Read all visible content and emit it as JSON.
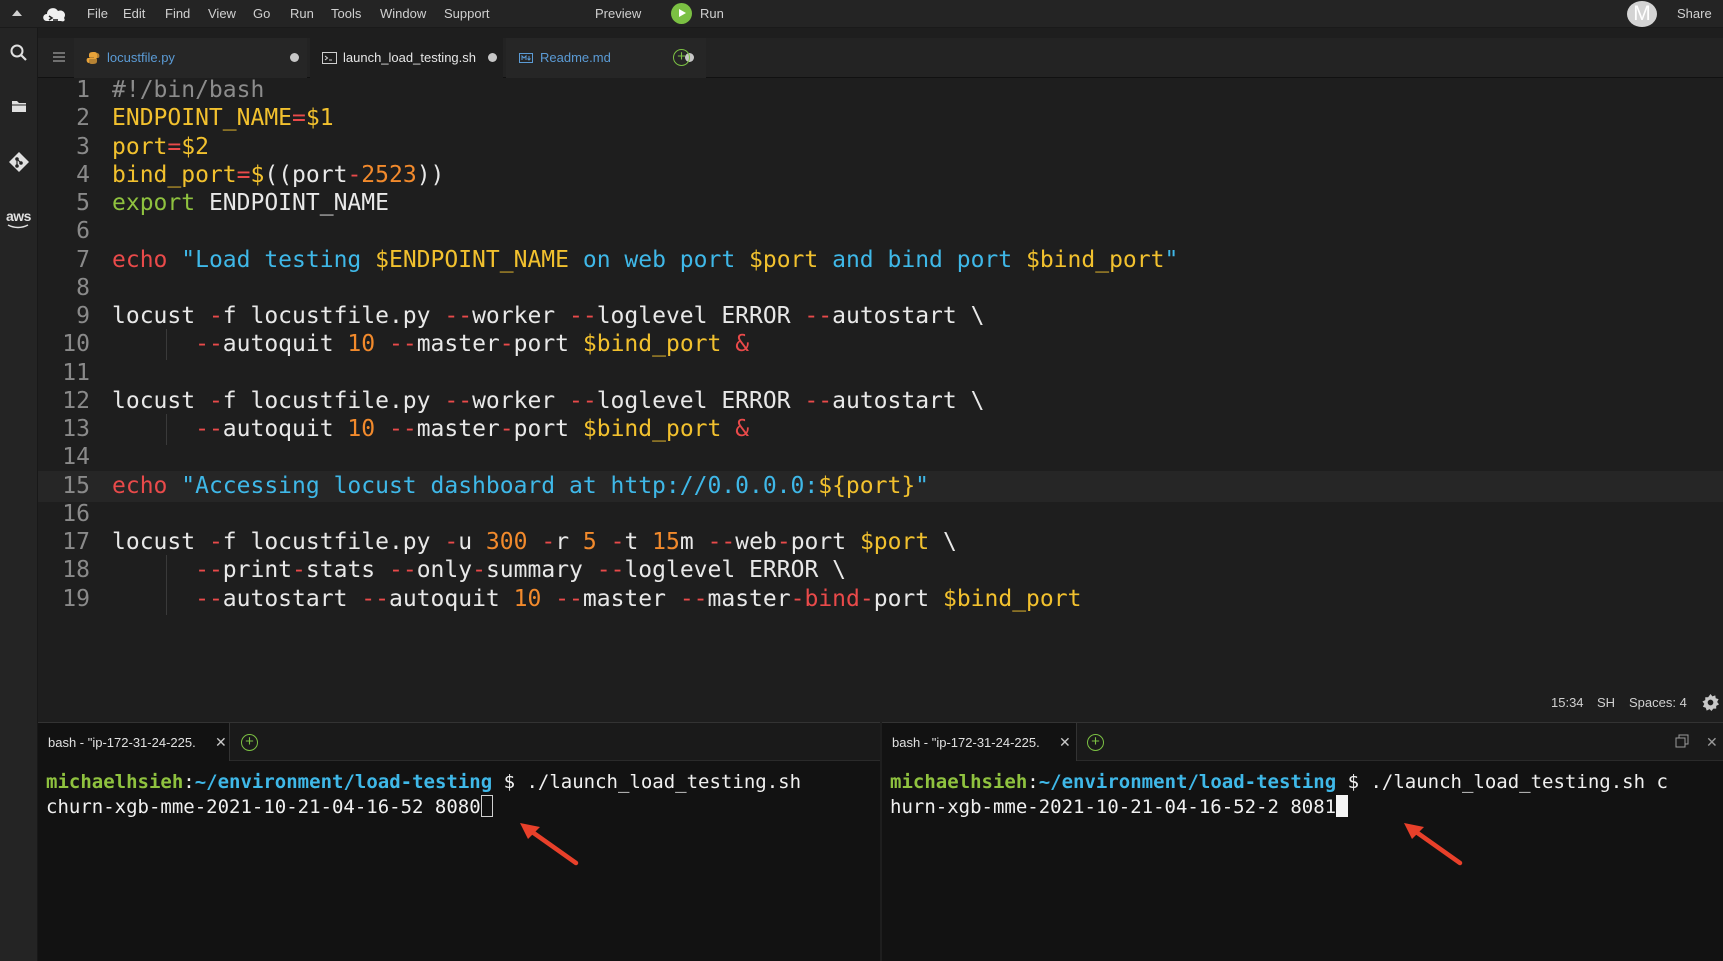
{
  "menubar": {
    "items": [
      "File",
      "Edit",
      "Find",
      "View",
      "Go",
      "Run",
      "Tools",
      "Window",
      "Support"
    ],
    "preview_label": "Preview",
    "run_label": "Run",
    "avatar_letter": "M",
    "share_label": "Share"
  },
  "sidebar": {
    "icons": [
      "search-icon",
      "folder-icon",
      "git-icon",
      "aws-icon"
    ],
    "aws_label": "aws"
  },
  "editor_tabs": [
    {
      "label": "locustfile.py",
      "icon": "python-icon",
      "unsaved": true,
      "active": false
    },
    {
      "label": "launch_load_testing.sh",
      "icon": "terminal-file-icon",
      "unsaved": true,
      "active": true
    },
    {
      "label": "Readme.md",
      "icon": "markdown-icon",
      "unsaved": true,
      "active": false
    }
  ],
  "code": {
    "current_line": 15,
    "lines": [
      {
        "n": "1",
        "tokens": [
          [
            "#!/bin/bash",
            "cmt"
          ]
        ]
      },
      {
        "n": "2",
        "tokens": [
          [
            "ENDPOINT_NAME",
            "var"
          ],
          [
            "=",
            "op"
          ],
          [
            "$1",
            "var"
          ]
        ]
      },
      {
        "n": "3",
        "tokens": [
          [
            "port",
            "var"
          ],
          [
            "=",
            "op"
          ],
          [
            "$2",
            "var"
          ]
        ]
      },
      {
        "n": "4",
        "tokens": [
          [
            "bind_port",
            "var"
          ],
          [
            "=",
            "op"
          ],
          [
            "$",
            "var"
          ],
          [
            "((port",
            "plain"
          ],
          [
            "-",
            "op"
          ],
          [
            "2523",
            "num"
          ],
          [
            "))",
            "plain"
          ]
        ]
      },
      {
        "n": "5",
        "tokens": [
          [
            "export",
            "kw"
          ],
          [
            " ENDPOINT_NAME",
            "plain"
          ]
        ]
      },
      {
        "n": "6",
        "tokens": []
      },
      {
        "n": "7",
        "tokens": [
          [
            "echo",
            "echo"
          ],
          [
            " ",
            "plain"
          ],
          [
            "\"Load testing ",
            "str"
          ],
          [
            "$ENDPOINT_NAME",
            "var"
          ],
          [
            " on web port ",
            "str"
          ],
          [
            "$port",
            "var"
          ],
          [
            " and bind port ",
            "str"
          ],
          [
            "$bind_port",
            "var"
          ],
          [
            "\"",
            "str"
          ]
        ]
      },
      {
        "n": "8",
        "tokens": []
      },
      {
        "n": "9",
        "tokens": [
          [
            "locust ",
            "plain"
          ],
          [
            "-",
            "op"
          ],
          [
            "f locustfile.py ",
            "plain"
          ],
          [
            "--",
            "op"
          ],
          [
            "worker ",
            "plain"
          ],
          [
            "--",
            "op"
          ],
          [
            "loglevel ERROR ",
            "plain"
          ],
          [
            "--",
            "op"
          ],
          [
            "autostart \\",
            "plain"
          ]
        ]
      },
      {
        "n": "10",
        "indent": true,
        "tokens": [
          [
            "      ",
            "plain"
          ],
          [
            "--",
            "op"
          ],
          [
            "autoquit ",
            "plain"
          ],
          [
            "10",
            "num"
          ],
          [
            " ",
            "plain"
          ],
          [
            "--",
            "op"
          ],
          [
            "master",
            "plain"
          ],
          [
            "-",
            "op"
          ],
          [
            "port ",
            "plain"
          ],
          [
            "$bind_port",
            "var"
          ],
          [
            " ",
            "plain"
          ],
          [
            "&",
            "op"
          ]
        ]
      },
      {
        "n": "11",
        "tokens": []
      },
      {
        "n": "12",
        "tokens": [
          [
            "locust ",
            "plain"
          ],
          [
            "-",
            "op"
          ],
          [
            "f locustfile.py ",
            "plain"
          ],
          [
            "--",
            "op"
          ],
          [
            "worker ",
            "plain"
          ],
          [
            "--",
            "op"
          ],
          [
            "loglevel ERROR ",
            "plain"
          ],
          [
            "--",
            "op"
          ],
          [
            "autostart \\",
            "plain"
          ]
        ]
      },
      {
        "n": "13",
        "indent": true,
        "tokens": [
          [
            "      ",
            "plain"
          ],
          [
            "--",
            "op"
          ],
          [
            "autoquit ",
            "plain"
          ],
          [
            "10",
            "num"
          ],
          [
            " ",
            "plain"
          ],
          [
            "--",
            "op"
          ],
          [
            "master",
            "plain"
          ],
          [
            "-",
            "op"
          ],
          [
            "port ",
            "plain"
          ],
          [
            "$bind_port",
            "var"
          ],
          [
            " ",
            "plain"
          ],
          [
            "&",
            "op"
          ]
        ]
      },
      {
        "n": "14",
        "tokens": []
      },
      {
        "n": "15",
        "tokens": [
          [
            "echo",
            "echo"
          ],
          [
            " ",
            "plain"
          ],
          [
            "\"Accessing locust dashboard at http://0.0.0.0:",
            "str"
          ],
          [
            "${port}",
            "var"
          ],
          [
            "\"",
            "str"
          ]
        ]
      },
      {
        "n": "16",
        "tokens": []
      },
      {
        "n": "17",
        "tokens": [
          [
            "locust ",
            "plain"
          ],
          [
            "-",
            "op"
          ],
          [
            "f locustfile.py ",
            "plain"
          ],
          [
            "-",
            "op"
          ],
          [
            "u ",
            "plain"
          ],
          [
            "300",
            "num"
          ],
          [
            " ",
            "plain"
          ],
          [
            "-",
            "op"
          ],
          [
            "r ",
            "plain"
          ],
          [
            "5",
            "num"
          ],
          [
            " ",
            "plain"
          ],
          [
            "-",
            "op"
          ],
          [
            "t ",
            "plain"
          ],
          [
            "15",
            "num"
          ],
          [
            "m ",
            "plain"
          ],
          [
            "--",
            "op"
          ],
          [
            "web",
            "plain"
          ],
          [
            "-",
            "op"
          ],
          [
            "port ",
            "plain"
          ],
          [
            "$port",
            "var"
          ],
          [
            " \\",
            "plain"
          ]
        ]
      },
      {
        "n": "18",
        "indent": true,
        "tokens": [
          [
            "      ",
            "plain"
          ],
          [
            "--",
            "op"
          ],
          [
            "print",
            "plain"
          ],
          [
            "-",
            "op"
          ],
          [
            "stats ",
            "plain"
          ],
          [
            "--",
            "op"
          ],
          [
            "only",
            "plain"
          ],
          [
            "-",
            "op"
          ],
          [
            "summary ",
            "plain"
          ],
          [
            "--",
            "op"
          ],
          [
            "loglevel ERROR \\",
            "plain"
          ]
        ]
      },
      {
        "n": "19",
        "indent": true,
        "tokens": [
          [
            "      ",
            "plain"
          ],
          [
            "--",
            "op"
          ],
          [
            "autostart ",
            "plain"
          ],
          [
            "--",
            "op"
          ],
          [
            "autoquit ",
            "plain"
          ],
          [
            "10",
            "num"
          ],
          [
            " ",
            "plain"
          ],
          [
            "--",
            "op"
          ],
          [
            "master ",
            "plain"
          ],
          [
            "--",
            "op"
          ],
          [
            "master",
            "plain"
          ],
          [
            "-",
            "op"
          ],
          [
            "bind",
            "op"
          ],
          [
            "-",
            "op"
          ],
          [
            "port ",
            "plain"
          ],
          [
            "$bind_port",
            "var"
          ]
        ]
      }
    ]
  },
  "status": {
    "cursor_position": "15:34",
    "language": "SH",
    "spaces": "Spaces: 4"
  },
  "terminals": [
    {
      "tab_label": "bash - \"ip-172-31-24-225.",
      "user": "michaelhsieh",
      "colon": ":",
      "path": "~/environment/load-testing",
      "command": " $ ./launch_load_testing.sh",
      "line2": "churn-xgb-mme-2021-10-21-04-16-52 8080",
      "cursor": "hollow"
    },
    {
      "tab_label": "bash - \"ip-172-31-24-225.",
      "user": "michaelhsieh",
      "colon": ":",
      "path": "~/environment/load-testing",
      "command": " $ ./launch_load_testing.sh c",
      "line2": "hurn-xgb-mme-2021-10-21-04-16-52-2 8081",
      "cursor": "solid"
    }
  ],
  "colors": {
    "annotation_arrow": "#e8402a",
    "accent_green": "#7bc043",
    "string_blue": "#3fb8e8",
    "variable_yellow": "#f2c12e"
  }
}
